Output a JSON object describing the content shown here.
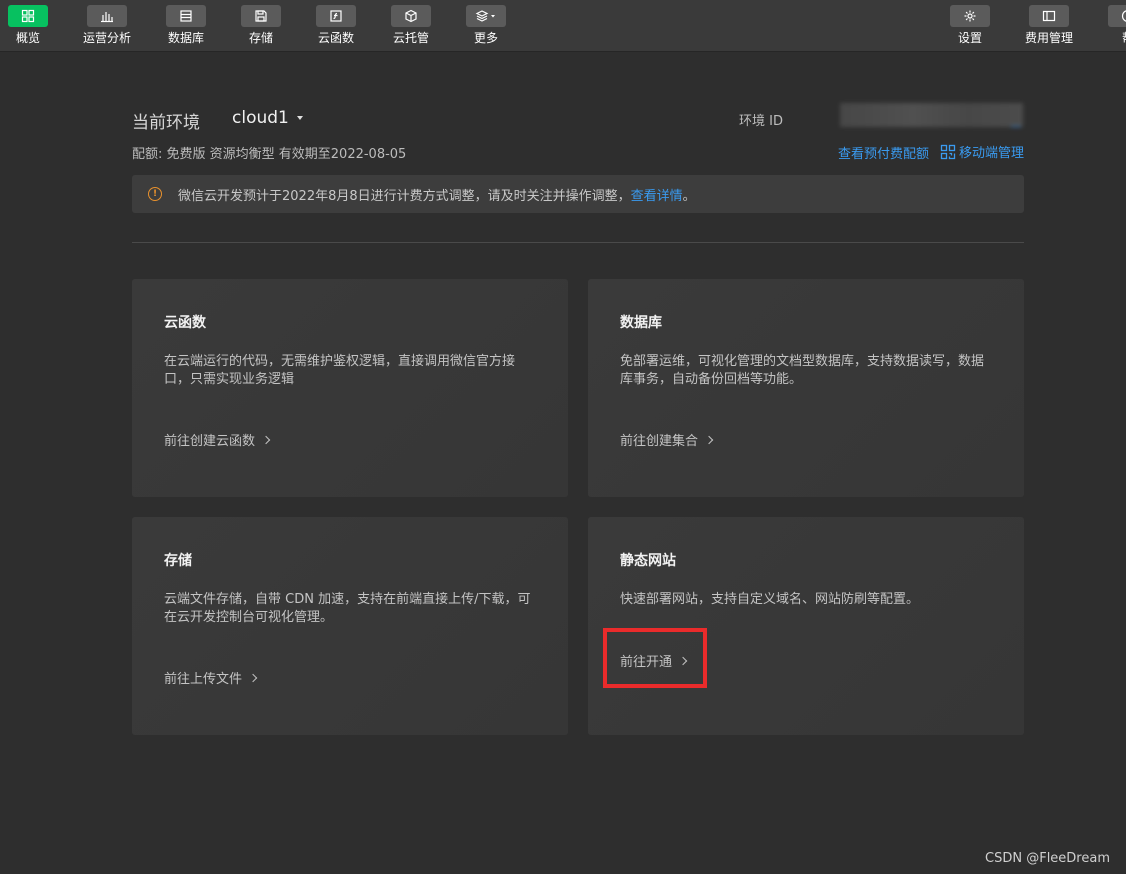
{
  "toolbar": {
    "left": [
      {
        "id": "overview",
        "label": "概览",
        "icon": "grid-icon",
        "active": true
      },
      {
        "id": "analytics",
        "label": "运营分析",
        "icon": "bar-chart-icon"
      },
      {
        "id": "database",
        "label": "数据库",
        "icon": "database-icon"
      },
      {
        "id": "storage",
        "label": "存储",
        "icon": "storage-icon"
      },
      {
        "id": "functions",
        "label": "云函数",
        "icon": "function-icon"
      },
      {
        "id": "hosting",
        "label": "云托管",
        "icon": "cube-icon"
      },
      {
        "id": "more",
        "label": "更多",
        "icon": "layers-icon"
      }
    ],
    "right": [
      {
        "id": "settings",
        "label": "设置",
        "icon": "gear-icon"
      },
      {
        "id": "billing",
        "label": "费用管理",
        "icon": "billing-icon"
      },
      {
        "id": "help",
        "label": "帮",
        "icon": "help-icon"
      }
    ]
  },
  "env": {
    "label": "当前环境",
    "name": "cloud1",
    "id_label": "环境 ID",
    "config": "配额: 免费版 资源均衡型 有效期至2022-08-05",
    "quota_link": "查看预付费配额",
    "mobile_link": "移动端管理"
  },
  "notice": {
    "text": "微信云开发预计于2022年8月8日进行计费方式调整，请及时关注并操作调整，",
    "link": "查看详情",
    "suffix": "。"
  },
  "cards": [
    {
      "title": "云函数",
      "desc": "在云端运行的代码，无需维护鉴权逻辑，直接调用微信官方接口，只需实现业务逻辑",
      "action": "前往创建云函数"
    },
    {
      "title": "数据库",
      "desc": "免部署运维，可视化管理的文档型数据库，支持数据读写，数据库事务，自动备份回档等功能。",
      "action": "前往创建集合"
    },
    {
      "title": "存储",
      "desc": "云端文件存储，自带 CDN 加速，支持在前端直接上传/下载，可在云开发控制台可视化管理。",
      "action": "前往上传文件"
    },
    {
      "title": "静态网站",
      "desc": "快速部署网站，支持自定义域名、网站防刷等配置。",
      "action": "前往开通"
    }
  ],
  "watermark": "CSDN @FleeDream",
  "colors": {
    "accent_green": "#07c160",
    "link_blue": "#3a9bf0",
    "warning_orange": "#e8912d",
    "highlight_red": "#ea2b2b"
  }
}
